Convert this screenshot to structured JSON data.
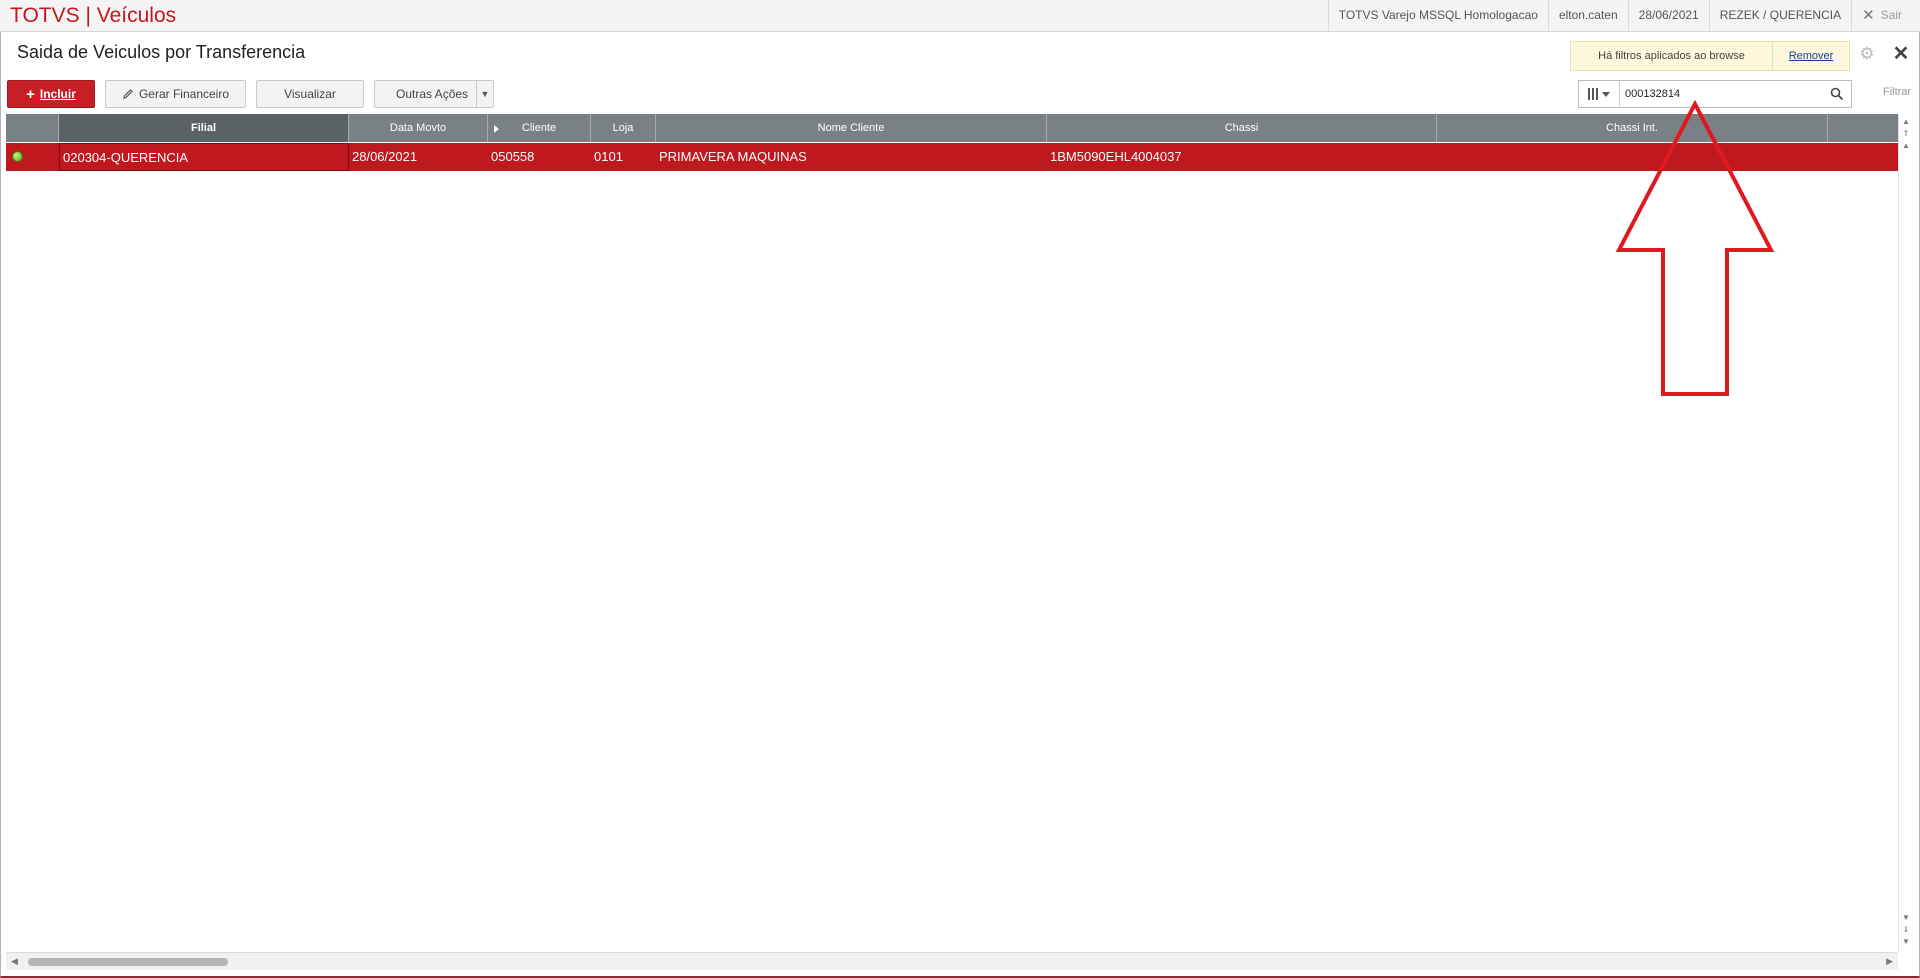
{
  "app": {
    "brand": "TOTVS | Veículos",
    "environment": "TOTVS Varejo MSSQL Homologacao",
    "user": "elton.caten",
    "date": "28/06/2021",
    "branch": "REZEK / QUERENCIA",
    "logout_label": "Sair"
  },
  "page": {
    "title": "Saida de Veiculos por Transferencia",
    "filter_notice": "Há filtros aplicados ao browse",
    "remove_label": "Remover"
  },
  "toolbar": {
    "incluir_label": "Incluir",
    "gerar_financeiro_label": "Gerar Financeiro",
    "visualizar_label": "Visualizar",
    "outras_acoes_label": "Outras Ações"
  },
  "search": {
    "value": "000132814",
    "filter_label": "Filtrar"
  },
  "grid": {
    "columns": [
      "Filial",
      "Data Movto",
      "Cliente",
      "Loja",
      "Nome Cliente",
      "Chassi",
      "Chassi Int."
    ],
    "rows": [
      {
        "status": "green",
        "filial": "020304-QUERENCIA",
        "data_movto": "28/06/2021",
        "cliente": "050558",
        "loja": "0101",
        "nome_cliente": "PRIMAVERA MAQUINAS",
        "chassi": "1BM5090EHL4004037",
        "chassi_int": ""
      }
    ]
  },
  "colors": {
    "brand_red": "#c2171d",
    "selected_row": "#c0181f",
    "header_gray": "#7a8185",
    "annotation": "#e0191f"
  }
}
